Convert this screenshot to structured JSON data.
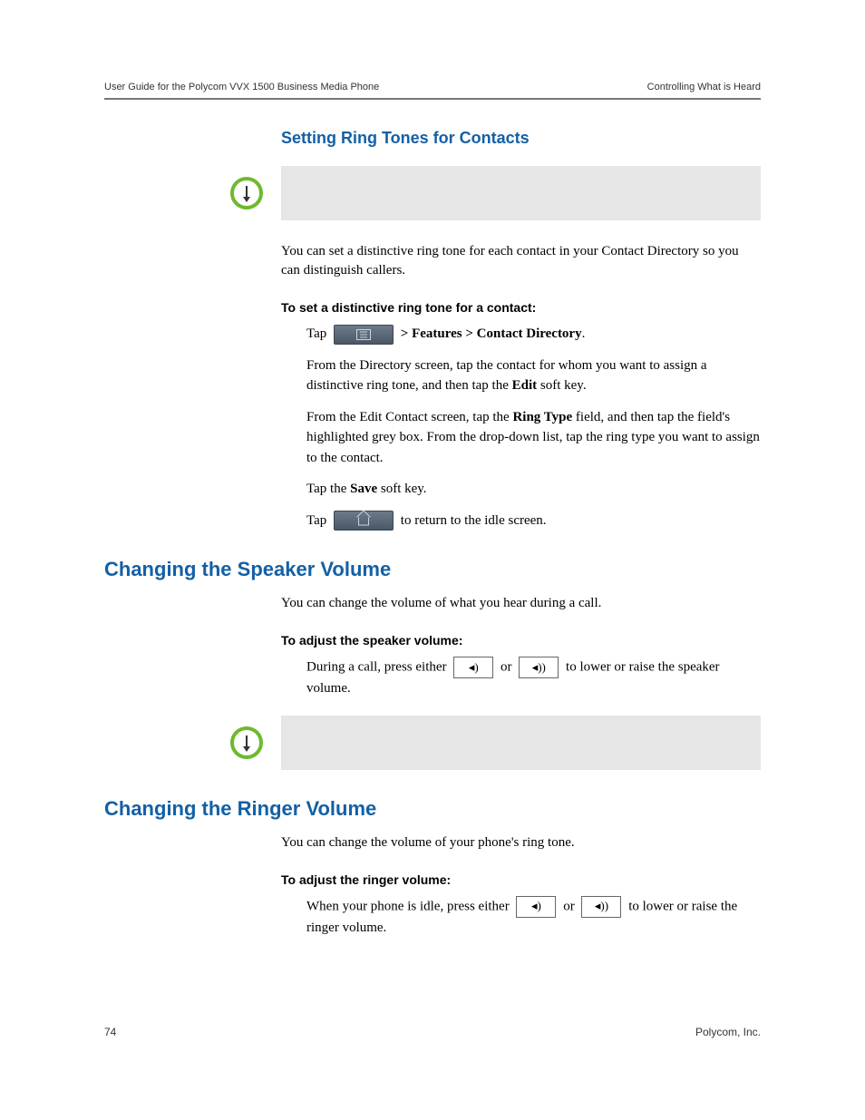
{
  "header": {
    "left": "User Guide for the Polycom VVX 1500 Business Media Phone",
    "right": "Controlling What is Heard"
  },
  "section1": {
    "title": "Setting Ring Tones for Contacts",
    "intro": "You can set a distinctive ring tone for each contact in your Contact Directory so you can distinguish callers.",
    "subhead": "To set a distinctive ring tone for a contact:",
    "step1_pre": "Tap",
    "step1_post_a": " > Features > Contact Directory",
    "step1_post_b": ".",
    "step2_pre": "From the Directory screen, tap the contact for whom you want to assign a distinctive ring tone, and then tap the ",
    "step2_bold": "Edit",
    "step2_post": " soft key.",
    "step3_pre": "From the Edit Contact screen, tap the ",
    "step3_bold": "Ring Type",
    "step3_post": " field, and then tap the field's highlighted grey box. From the drop-down list, tap the ring type you want to assign to the contact.",
    "step4_pre": "Tap the ",
    "step4_bold": "Save",
    "step4_post": " soft key.",
    "step5_pre": "Tap",
    "step5_post": " to return to the idle screen."
  },
  "section2": {
    "title": "Changing the Speaker Volume",
    "intro": "You can change the volume of what you hear during a call.",
    "subhead": "To adjust the speaker volume:",
    "step_pre": "During a call, press either",
    "or": "or",
    "step_post": "to lower or raise the speaker volume."
  },
  "section3": {
    "title": "Changing the Ringer Volume",
    "intro": "You can change the volume of your phone's ring tone.",
    "subhead": "To adjust the ringer volume:",
    "step_pre": "When your phone is idle, press either",
    "or": "or",
    "step_post": "to lower or raise the ringer volume."
  },
  "footer": {
    "page": "74",
    "company": "Polycom, Inc."
  },
  "icons": {
    "vol_down": "◂)",
    "vol_up": "◂))"
  }
}
